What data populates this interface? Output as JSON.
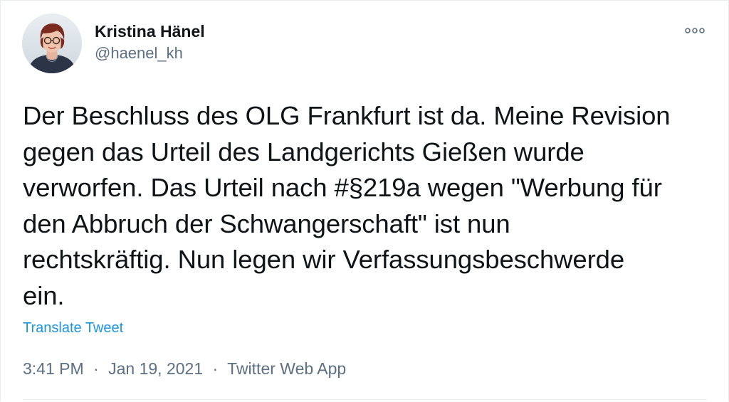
{
  "author": {
    "display_name": "Kristina Hänel",
    "handle": "@haenel_kh",
    "avatar_icon": "profile-photo"
  },
  "tweet": {
    "text": "Der Beschluss des OLG Frankfurt ist da. Meine Revision\ngegen das Urteil des Landgerichts Gießen wurde\nverworfen. Das Urteil nach #§219a wegen \"Werbung für\nden Abbruch der Schwangerschaft\" ist nun\nrechtskräftig. Nun legen wir Verfassungsbeschwerde\nein.",
    "translate_label": "Translate Tweet",
    "time": "3:41 PM",
    "date": "Jan 19, 2021",
    "separator": "·",
    "source": "Twitter Web App"
  },
  "colors": {
    "text": "#0f1419",
    "secondary": "#5b7083",
    "link": "#1b95e0",
    "border": "#e6ecf0"
  },
  "icons": {
    "more": "more-options-icon"
  }
}
